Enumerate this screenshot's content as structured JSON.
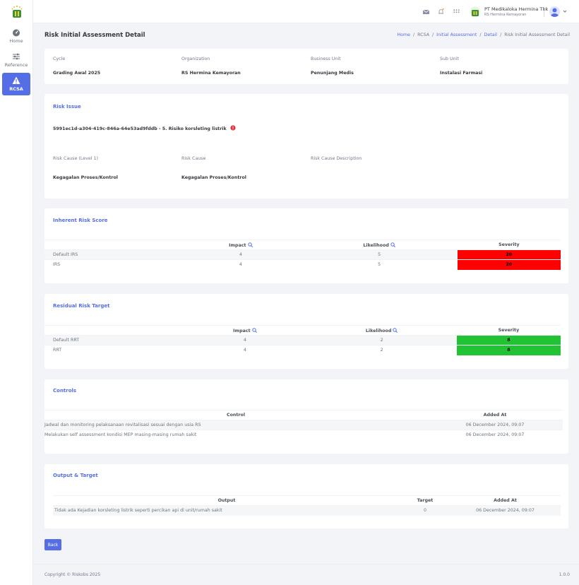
{
  "sidebar": {
    "items": [
      {
        "label": "Home",
        "icon": "dashboard-icon"
      },
      {
        "label": "Reference",
        "icon": "sliders-icon"
      },
      {
        "label": "RCSA",
        "icon": "warning-icon"
      }
    ]
  },
  "topbar": {
    "org_name": "PT Medikaloka Hermina Tbk",
    "org_sub": "RS Hermina Kemayoran"
  },
  "page": {
    "title": "Risk Initial Assessment Detail",
    "breadcrumb": [
      "Home",
      "RCSA",
      "Initial Assessment",
      "Detail",
      "Risk Initial Assessment Detail"
    ]
  },
  "info": {
    "cycle_label": "Cycle",
    "cycle_value": "Grading Awal 2025",
    "org_label": "Organization",
    "org_value": "RS Hermina Kemayoran",
    "bu_label": "Business Unit",
    "bu_value": "Penunjang Medis",
    "su_label": "Sub Unit",
    "su_value": "Instalasi Farmasi"
  },
  "risk_issue": {
    "title": "Risk Issue",
    "issue": "5991ec1d-a304-419c-846a-64e53ad9fddb - 5. Risiko korsleting listrik",
    "cause_l1_label": "Risk Cause (Level 1)",
    "cause_l1_value": "Kegagalan Proses/Kontrol",
    "cause_label": "Risk Cause",
    "cause_value": "Kegagalan Proses/Kontrol",
    "cause_desc_label": "Risk Cause Description"
  },
  "inherent": {
    "title": "Inherent Risk Score",
    "headers": [
      "",
      "Impact",
      "Likelihood",
      "Severity"
    ],
    "rows": [
      {
        "name": "Default IRS",
        "impact": "4",
        "likelihood": "5",
        "severity": "20"
      },
      {
        "name": "IRS",
        "impact": "4",
        "likelihood": "5",
        "severity": "20"
      }
    ],
    "severity_color": "#ff0000"
  },
  "residual": {
    "title": "Residual Risk Target",
    "headers": [
      "",
      "Impact",
      "Likelihood",
      "Severity"
    ],
    "rows": [
      {
        "name": "Default RRT",
        "impact": "4",
        "likelihood": "2",
        "severity": "8"
      },
      {
        "name": "RRT",
        "impact": "4",
        "likelihood": "2",
        "severity": "8"
      }
    ],
    "severity_color": "#22c235"
  },
  "controls": {
    "title": "Controls",
    "headers": [
      "Control",
      "Added At"
    ],
    "rows": [
      {
        "control": "Jadwal dan monitoring pelaksanaan revitalisasi sesuai dengan usia RS",
        "added": "06 December 2024, 09:07"
      },
      {
        "control": "Melakukan self assessment kondisi MEP masing-masing rumah sakit",
        "added": "06 December 2024, 09:07"
      }
    ]
  },
  "output": {
    "title": "Output & Target",
    "headers": [
      "Output",
      "Target",
      "Added At"
    ],
    "rows": [
      {
        "output": "Tidak ada Kejadian korsleting listrik seperti percikan api di unit/rumah sakit",
        "target": "0",
        "added": "06 December 2024, 09:07"
      }
    ]
  },
  "back_label": "Back",
  "footer": {
    "copyright": "Copyright © Riskobs 2025",
    "version": "1.0.0"
  },
  "colors": {
    "accent": "#556ee6",
    "danger": "#ff0000",
    "success": "#22c235"
  }
}
